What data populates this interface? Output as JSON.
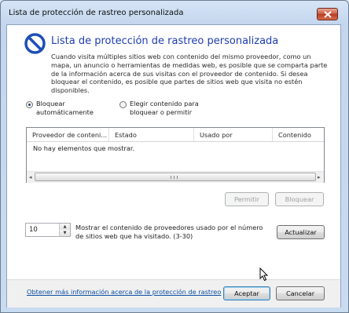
{
  "window": {
    "title": "Lista de protección de rastreo personalizada"
  },
  "header": {
    "heading": "Lista de protección de rastreo personalizada",
    "description": "Cuando visita múltiples sitios web con contenido del mismo proveedor, como un mapa, un anuncio o herramientas de medidas web, es posible que se comparta parte de la información acerca de sus visitas con el proveedor de contenido. Si desea bloquear el contenido, es posible que partes de sitios web que visita no estén disponibles."
  },
  "options": {
    "block_auto_line1": "Bloquear",
    "block_auto_line2": "automáticamente",
    "block_auto_selected": true,
    "choose_line1": "Elegir contenido para",
    "choose_line2": "bloquear o permitir",
    "choose_selected": false
  },
  "list": {
    "columns": [
      "Proveedor de conteni...",
      "Estado",
      "Usado por",
      "Contenido"
    ],
    "empty_text": "No hay elementos que mostrar."
  },
  "list_actions": {
    "allow_label": "Permitir",
    "block_label": "Bloquear"
  },
  "threshold": {
    "value": "10",
    "text": "Mostrar el contenido de proveedores usado por el número de sitios web que ha visitado. (3-30)",
    "refresh_label": "Actualizar"
  },
  "footer": {
    "link_text": "Obtener más información acerca de la protección de rastreo",
    "ok_label": "Aceptar",
    "cancel_label": "Cancelar"
  },
  "colors": {
    "heading": "#1d3cb0",
    "link": "#0d4fa3",
    "close_button": "#c5563f"
  }
}
